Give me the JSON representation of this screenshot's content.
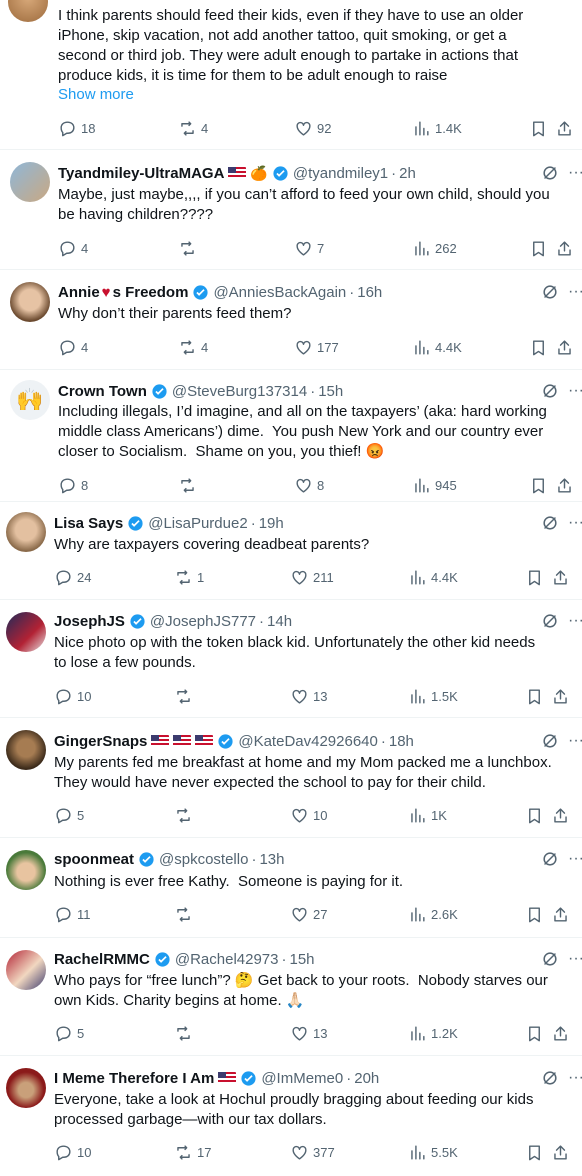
{
  "tweets": [
    {
      "text": "I think parents should feed their kids, even if they have to use an older\niPhone, skip vacation, not add another tattoo, quit smoking, or get a\nsecond or third job. They were adult enough to partake in actions that\nproduce kids, it is time for them to be adult enough to raise",
      "show_more": "Show more",
      "replies": "18",
      "reposts": "4",
      "likes": "92",
      "views": "1.4K"
    },
    {
      "name": "Tyandmiley-UltraMAGA",
      "handle": "@tyandmiley1",
      "time": "2h",
      "text": "Maybe, just maybe,,,, if you can’t afford to feed your own child, should you\nbe having children????",
      "replies": "4",
      "reposts": "",
      "likes": "7",
      "views": "262"
    },
    {
      "name": "Annie",
      "name2": "s Freedom",
      "handle": "@AnniesBackAgain",
      "time": "16h",
      "text": "Why don’t their parents feed them?",
      "replies": "4",
      "reposts": "4",
      "likes": "177",
      "views": "4.4K"
    },
    {
      "name": "Crown Town",
      "handle": "@SteveBurg137314",
      "time": "15h",
      "text": "Including illegals, I’d imagine, and all on the taxpayers’ (aka: hard working\nmiddle class Americans’) dime.  You push New York and our country ever\ncloser to Socialism.  Shame on you, you thief! 😡",
      "replies": "8",
      "reposts": "",
      "likes": "8",
      "views": "945"
    },
    {
      "name": "Lisa Says",
      "handle": "@LisaPurdue2",
      "time": "19h",
      "text": "Why are taxpayers covering deadbeat parents?",
      "replies": "24",
      "reposts": "1",
      "likes": "211",
      "views": "4.4K"
    },
    {
      "name": "JosephJS",
      "handle": "@JosephJS777",
      "time": "14h",
      "text": "Nice photo op with the token black kid. Unfortunately the other kid needs\nto lose a few pounds.",
      "replies": "10",
      "reposts": "",
      "likes": "13",
      "views": "1.5K"
    },
    {
      "name": "GingerSnaps",
      "handle": "@KateDav42926640",
      "time": "18h",
      "text": "My parents fed me breakfast at home and my Mom packed me a lunchbox.\nThey would have never expected the school to pay for their child.",
      "replies": "5",
      "reposts": "",
      "likes": "10",
      "views": "1K"
    },
    {
      "name": "spoonmeat",
      "handle": "@spkcostello",
      "time": "13h",
      "text": "Nothing is ever free Kathy.  Someone is paying for it.",
      "replies": "11",
      "reposts": "",
      "likes": "27",
      "views": "2.6K"
    },
    {
      "name": "RachelRMMC",
      "handle": "@Rachel42973",
      "time": "15h",
      "text": "Who pays for “free lunch”? 🤔 Get back to your roots.  Nobody starves our\nown Kids. Charity begins at home. 🙏🏻",
      "replies": "5",
      "reposts": "",
      "likes": "13",
      "views": "1.2K"
    },
    {
      "name": "I Meme Therefore I Am",
      "handle": "@ImMeme0",
      "time": "20h",
      "text": "Everyone, take a look at Hochul proudly bragging about feeding our kids\nprocessed garbage—with our tax dollars.",
      "replies": "10",
      "reposts": "17",
      "likes": "377",
      "views": "5.5K"
    }
  ],
  "colors": {
    "accent": "#1d9bf0",
    "muted": "#536471",
    "text": "#0f1419",
    "divider": "#eff3f4"
  },
  "icons": [
    "reply-icon",
    "repost-icon",
    "like-icon",
    "views-icon",
    "bookmark-icon",
    "share-icon",
    "grok-icon",
    "more-icon",
    "verified-icon",
    "us-flag-icon"
  ]
}
